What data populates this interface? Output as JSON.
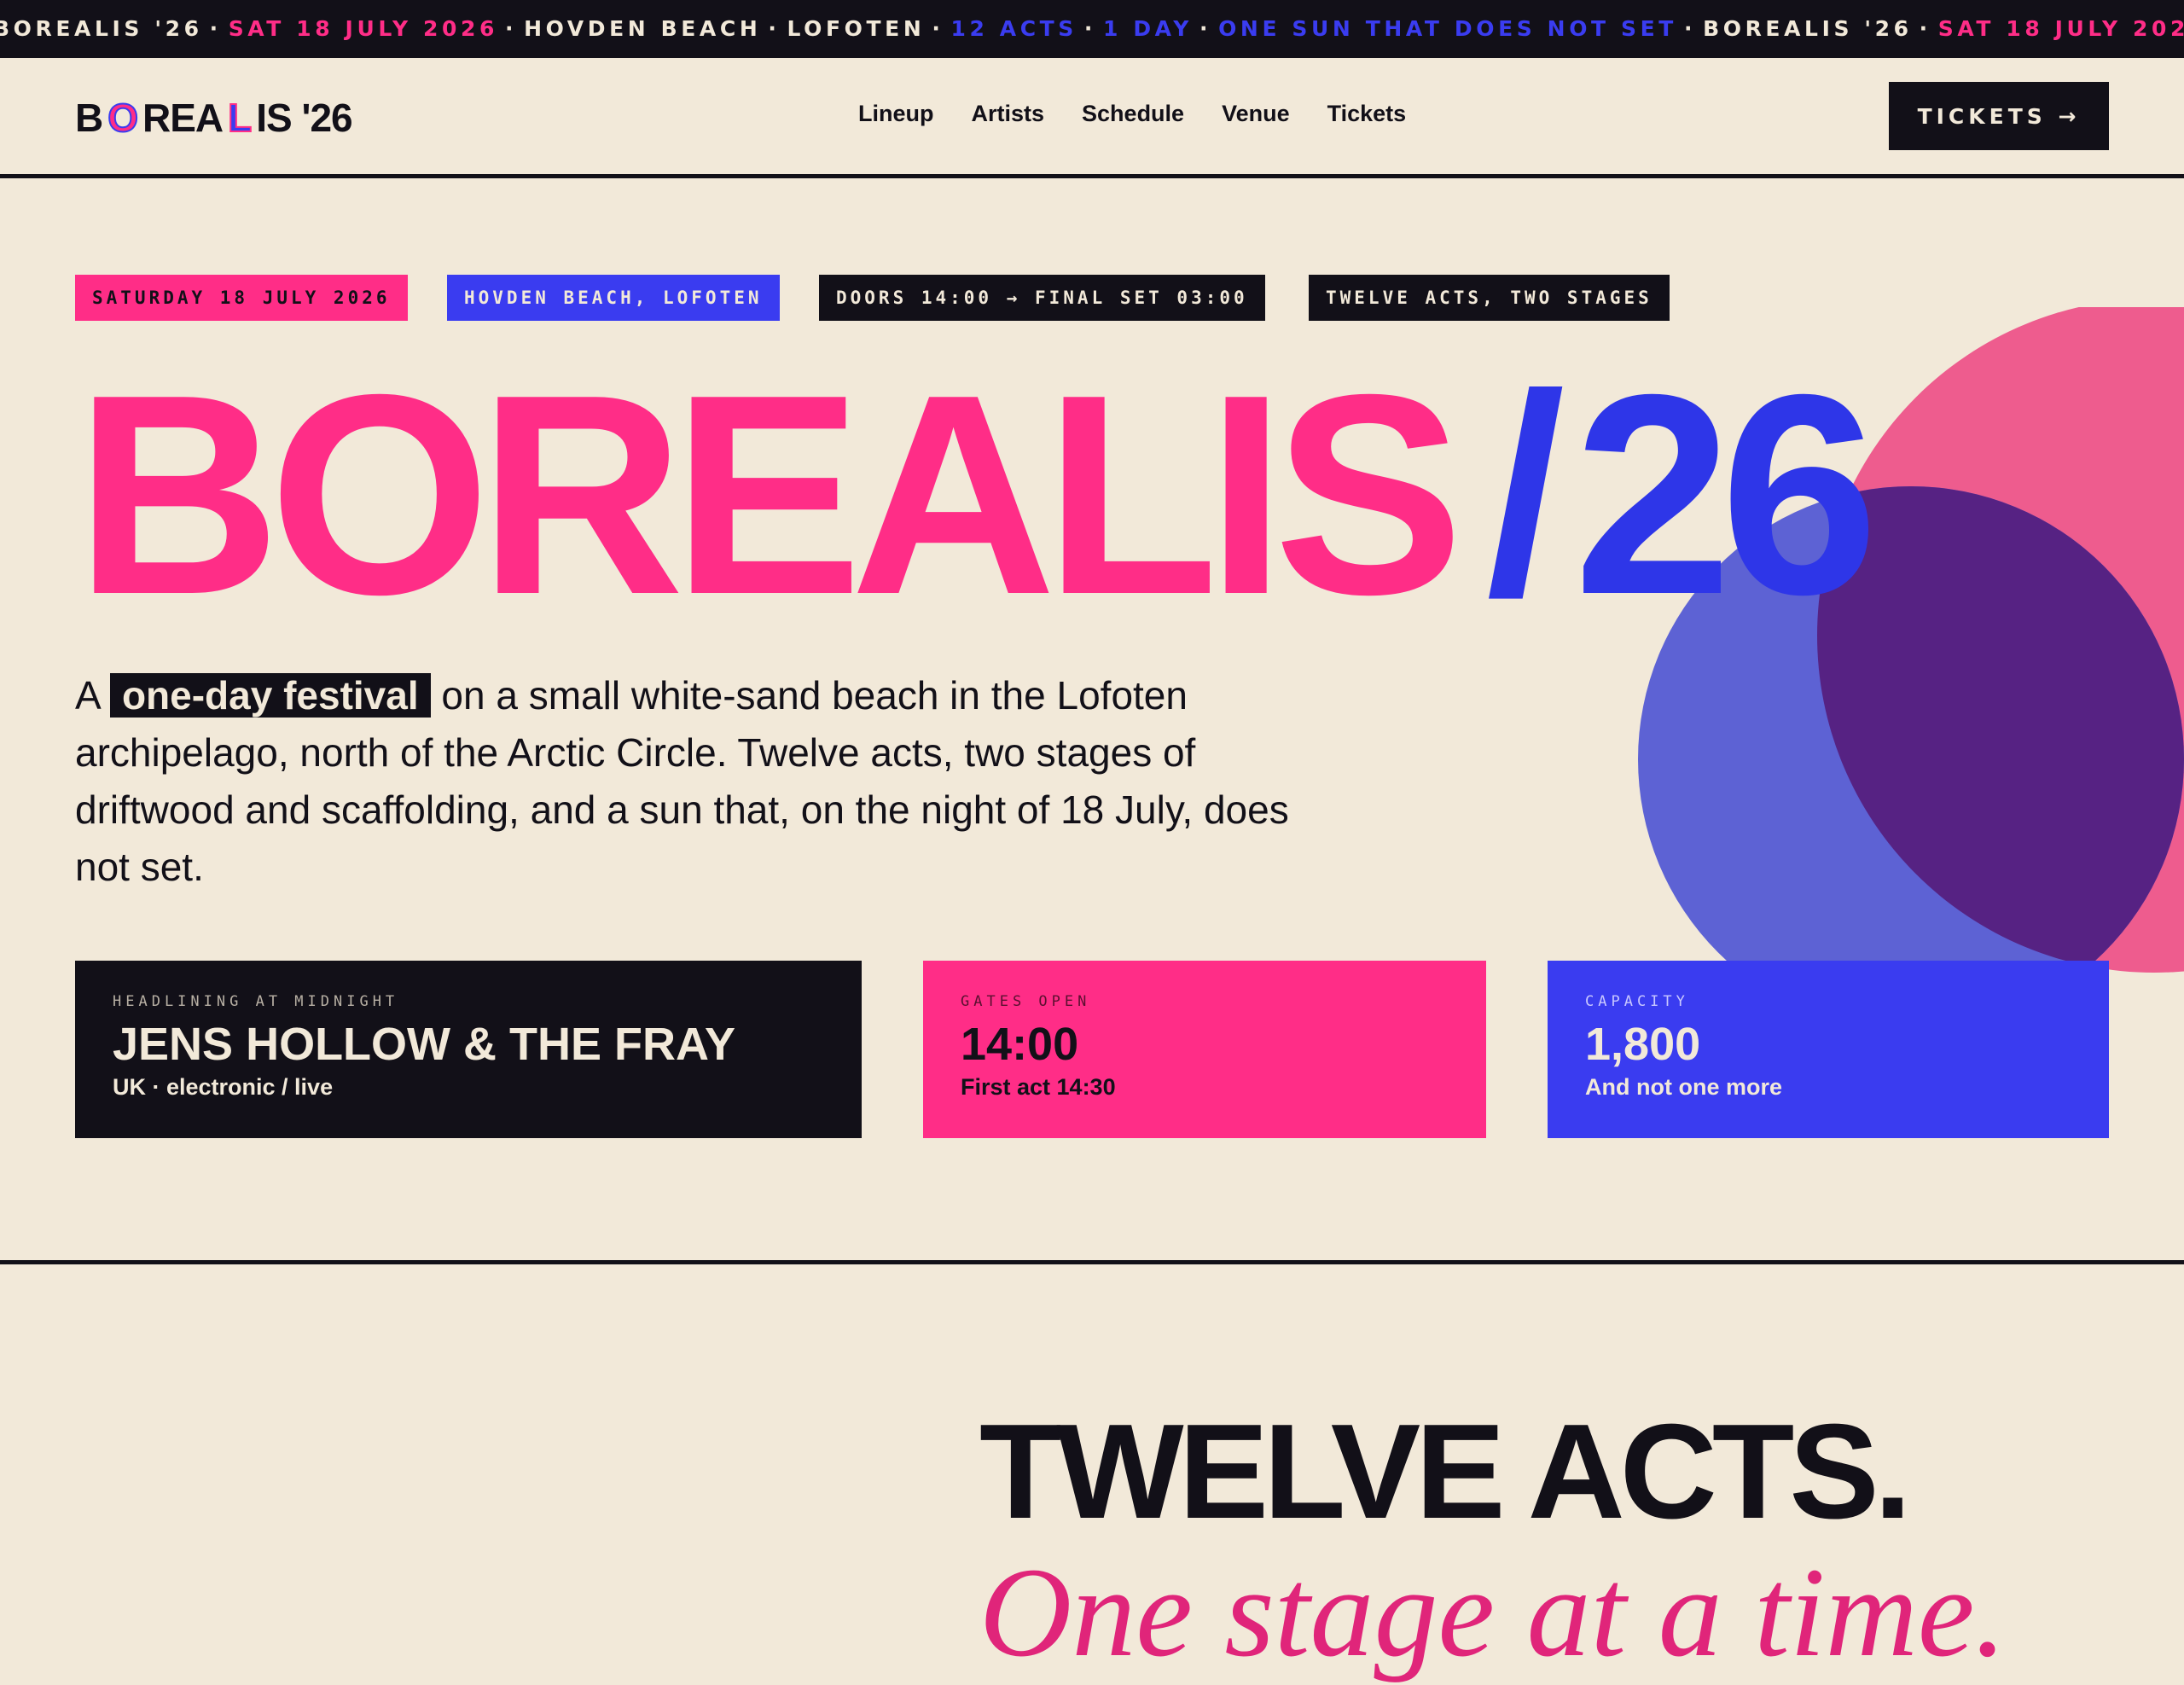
{
  "ticker": {
    "items": [
      {
        "text": "BOREALIS '26",
        "color": "white"
      },
      {
        "text": "SAT 18 JULY 2026",
        "color": "pink"
      },
      {
        "text": "HOVDEN BEACH",
        "color": "white"
      },
      {
        "text": "LOFOTEN",
        "color": "white"
      },
      {
        "text": "12 ACTS",
        "color": "blue"
      },
      {
        "text": "1 DAY",
        "color": "blue"
      },
      {
        "text": "ONE SUN THAT DOES NOT SET",
        "color": "blue"
      }
    ],
    "separator": "·"
  },
  "nav": {
    "logo": {
      "b": "B",
      "o": "O",
      "rea": "REA",
      "l": "L",
      "is": "IS",
      "year": "'26"
    },
    "links": [
      "Lineup",
      "Artists",
      "Schedule",
      "Venue",
      "Tickets"
    ],
    "cta_label": "TICKETS →"
  },
  "chips": [
    "SATURDAY 18 JULY 2026",
    "HOVDEN BEACH, LOFOTEN",
    "DOORS 14:00 → FINAL SET 03:00",
    "TWELVE ACTS, TWO STAGES"
  ],
  "hero": {
    "title_word": "BOREALIS",
    "title_slash": "/",
    "title_year": "26",
    "intro_prefix": "A",
    "intro_highlight": "one-day festival",
    "intro_rest": "on a small white-sand beach in the Lofoten archipelago, north of the Arctic Circle. Twelve acts, two stages of driftwood and scaffolding, and a sun that, on the night of 18 July, does not set."
  },
  "cards": {
    "headliner": {
      "label": "HEADLINING AT MIDNIGHT",
      "value": "JENS HOLLOW & THE FRAY",
      "sub": "UK · electronic / live"
    },
    "gates": {
      "label": "GATES OPEN",
      "value": "14:00",
      "sub": "First act 14:30"
    },
    "capacity": {
      "label": "CAPACITY",
      "value": "1,800",
      "sub": "And not one more"
    }
  },
  "section2": {
    "title": "TWELVE ACTS.",
    "subtitle": "One stage at a time."
  },
  "colors": {
    "background": "#f2e9d9",
    "ink": "#121018",
    "pink": "#ff2d87",
    "blue": "#3a3cf0",
    "purple": "#5a2383"
  }
}
